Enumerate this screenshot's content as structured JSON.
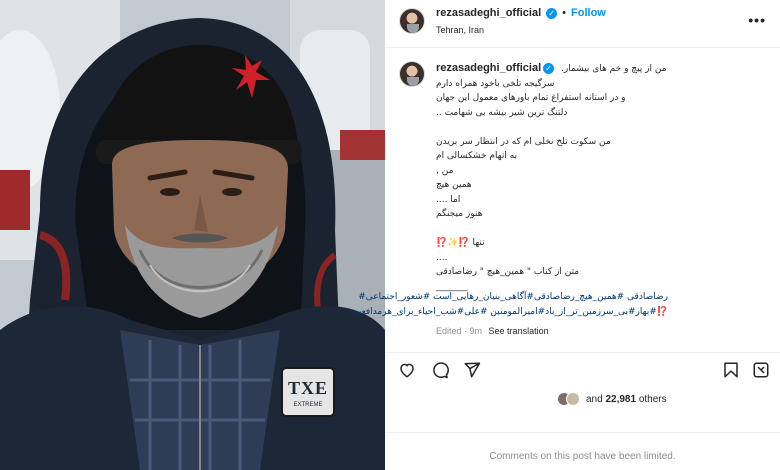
{
  "post": {
    "username": "rezasadeghi_official",
    "verified_glyph": "✓",
    "separator": "•",
    "follow_label": "Follow",
    "location": "Tehran, Iran",
    "more_icon": "more-options-icon"
  },
  "photo": {
    "logo_text": "TXE",
    "logo_small": "EXTREME"
  },
  "caption": {
    "username": "rezasadeghi_official",
    "lines": [
      "من از پیچ و خم های بیشمار.",
      "سرگیجه تلخی باخود همراه دارم",
      "و در استانه استفراغ تمام باورهای معمول این جهان",
      "دلتنگ ترین شیر بیشه بی شهامت ..",
      "",
      "من سکوت تلخ نخلی ام که در انتظار سر بریدن",
      "به اتهام خشکسالی ام",
      "من ,",
      "همین هیچ",
      "اما ....",
      "هنوز میجنگم",
      "",
      "تنها ⁉️✨⁉️",
      "....",
      "متن از کتاب \" همین_هیچ \" رضاصادقی",
      "_______"
    ],
    "hashtags": [
      "رضاصادقی #همین_هیچ_رضاصادقی#آگاهی_بنیان_رهایی_است #شعور_اجتماعی#",
      "⁉️#بهار#بی_سرزمین_تر_از_باد#امیرالمومنین #علی#شب_احیاء_برای_هرمدافعیم"
    ],
    "edited": "Edited · 9m",
    "see_translation": "See translation"
  },
  "actions": {
    "like_icon": "heart-icon",
    "comment_icon": "comment-icon",
    "share_icon": "share-icon",
    "save_icon": "bookmark-icon",
    "more_icon": "more-actions-icon"
  },
  "likes": {
    "connector": "and",
    "count": "22,981",
    "suffix": "others"
  },
  "comments_notice": "Comments on this post have been limited.",
  "colors": {
    "link_blue": "#0095f6",
    "hashtag_blue": "#00376b",
    "muted": "#8e8e8e",
    "text": "#262626"
  }
}
